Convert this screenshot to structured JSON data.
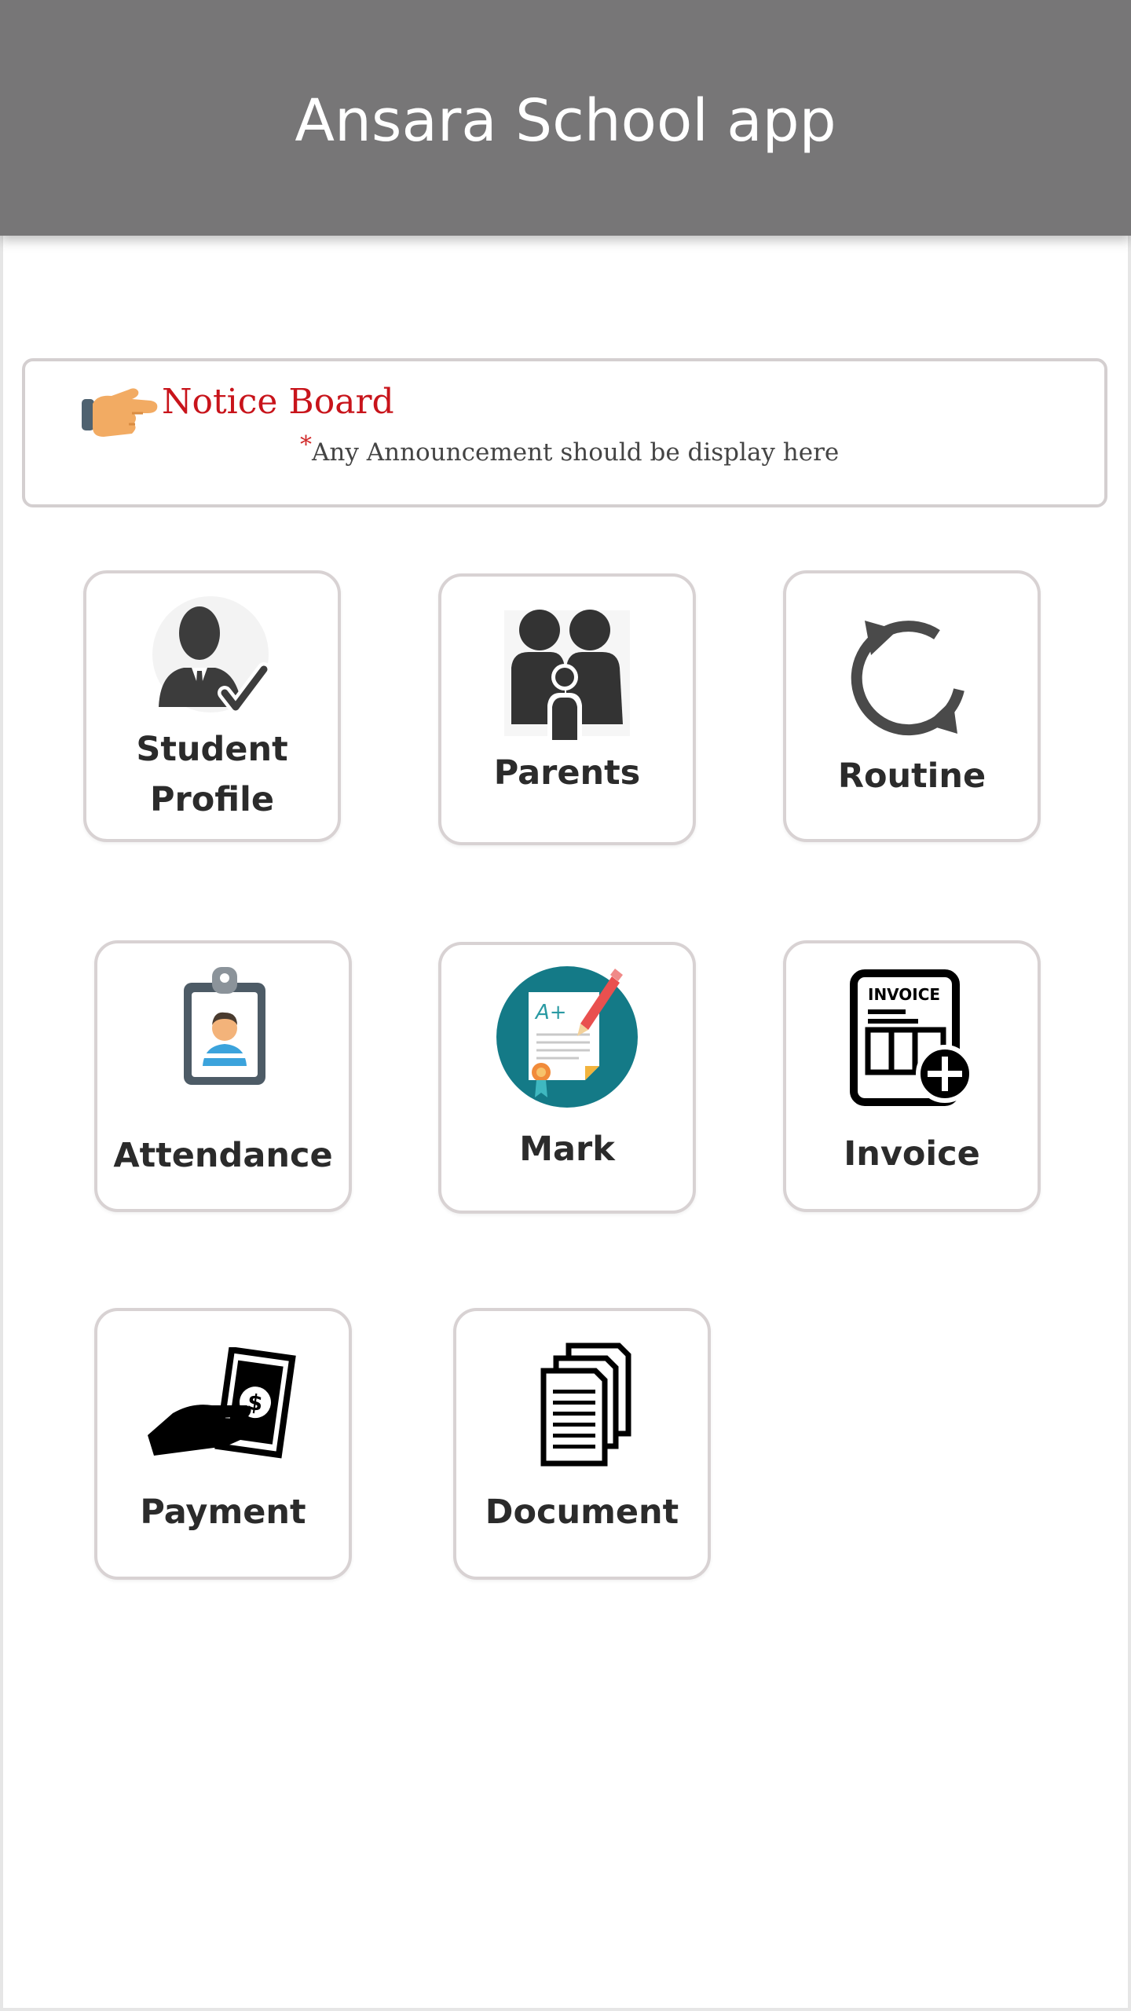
{
  "header": {
    "title": "Ansara School app"
  },
  "notice": {
    "title": "Notice Board",
    "star": "*",
    "message": "Any Announcement should be display here"
  },
  "menu": [
    {
      "line1": "Student",
      "line2": "Profile",
      "icon": "student-profile-icon"
    },
    {
      "label": "Parents",
      "icon": "parents-icon"
    },
    {
      "label": "Routine",
      "icon": "routine-refresh-icon"
    },
    {
      "label": "Attendance",
      "icon": "attendance-id-badge-icon"
    },
    {
      "label": "Mark",
      "icon": "mark-report-icon"
    },
    {
      "label": "Invoice",
      "icon": "invoice-icon"
    },
    {
      "label": "Payment",
      "icon": "payment-cash-icon"
    },
    {
      "label": "Document",
      "icon": "document-stack-icon"
    }
  ],
  "icon_texts": {
    "mark_grade": "A+",
    "invoice_heading": "INVOICE"
  },
  "colors": {
    "header_bg": "#777676",
    "notice_title": "#c8141b",
    "tile_border": "#d8d2d3",
    "mark_circle": "#147a87"
  }
}
